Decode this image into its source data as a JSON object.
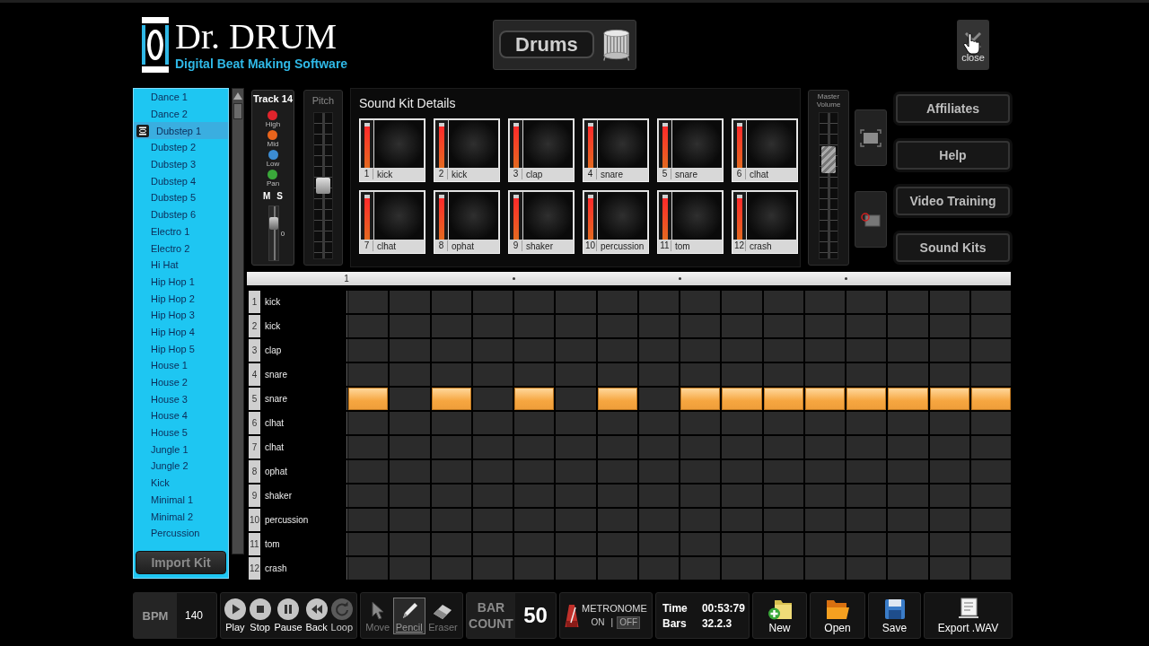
{
  "header": {
    "logo": {
      "title": "Dr. DRUM",
      "subtitle": "Digital Beat Making Software"
    },
    "instrument": {
      "label": "Drums"
    },
    "close": {
      "label": "close"
    }
  },
  "kits": {
    "items": [
      {
        "label": "Dance 1",
        "selected": false
      },
      {
        "label": "Dance 2",
        "selected": false
      },
      {
        "label": "Dubstep 1",
        "selected": true
      },
      {
        "label": "Dubstep 2",
        "selected": false
      },
      {
        "label": "Dubstep 3",
        "selected": false
      },
      {
        "label": "Dubstep 4",
        "selected": false
      },
      {
        "label": "Dubstep 5",
        "selected": false
      },
      {
        "label": "Dubstep 6",
        "selected": false
      },
      {
        "label": "Electro 1",
        "selected": false
      },
      {
        "label": "Electro 2",
        "selected": false
      },
      {
        "label": "Hi Hat",
        "selected": false
      },
      {
        "label": "Hip Hop 1",
        "selected": false
      },
      {
        "label": "Hip Hop 2",
        "selected": false
      },
      {
        "label": "Hip Hop 3",
        "selected": false
      },
      {
        "label": "Hip Hop 4",
        "selected": false
      },
      {
        "label": "Hip Hop 5",
        "selected": false
      },
      {
        "label": "House 1",
        "selected": false
      },
      {
        "label": "House 2",
        "selected": false
      },
      {
        "label": "House 3",
        "selected": false
      },
      {
        "label": "House 4",
        "selected": false
      },
      {
        "label": "House 5",
        "selected": false
      },
      {
        "label": "Jungle 1",
        "selected": false
      },
      {
        "label": "Jungle 2",
        "selected": false
      },
      {
        "label": "Kick",
        "selected": false
      },
      {
        "label": "Minimal 1",
        "selected": false
      },
      {
        "label": "Minimal 2",
        "selected": false
      },
      {
        "label": "Percussion",
        "selected": false
      }
    ],
    "import_button": "Import Kit"
  },
  "track": {
    "title": "Track 14",
    "knobs": [
      {
        "label": "High",
        "color": "#e0242c"
      },
      {
        "label": "Mid",
        "color": "#e8641c"
      },
      {
        "label": "Low",
        "color": "#3c8cd2"
      },
      {
        "label": "Pan",
        "color": "#3aa83a"
      }
    ],
    "mute_label": "M",
    "solo_label": "S",
    "volume": {
      "level": 0.75,
      "reading": "0"
    }
  },
  "pitch": {
    "label": "Pitch",
    "level": 0.5
  },
  "sound_kit": {
    "title": "Sound Kit Details",
    "pads": [
      {
        "number": "1",
        "name": "kick",
        "level": 0.95
      },
      {
        "number": "2",
        "name": "kick",
        "level": 0.95
      },
      {
        "number": "3",
        "name": "clap",
        "level": 0.95
      },
      {
        "number": "4",
        "name": "snare",
        "level": 0.95
      },
      {
        "number": "5",
        "name": "snare",
        "level": 0.95
      },
      {
        "number": "6",
        "name": "clhat",
        "level": 0.95
      },
      {
        "number": "7",
        "name": "clhat",
        "level": 0.95
      },
      {
        "number": "8",
        "name": "ophat",
        "level": 0.95
      },
      {
        "number": "9",
        "name": "shaker",
        "level": 0.95
      },
      {
        "number": "10",
        "name": "percussion",
        "level": 0.95
      },
      {
        "number": "11",
        "name": "tom",
        "level": 0.95
      },
      {
        "number": "12",
        "name": "crash",
        "level": 0.95
      }
    ]
  },
  "master_volume": {
    "label": "Master Volume",
    "level": 0.72
  },
  "menu": {
    "buttons": [
      "Affiliates",
      "Help",
      "Video Training",
      "Sound Kits"
    ]
  },
  "timeline": {
    "start_label": "1"
  },
  "grid": {
    "rows": [
      {
        "number": "1",
        "name": "kick",
        "steps": [
          false,
          false,
          false,
          false,
          false,
          false,
          false,
          false,
          false,
          false,
          false,
          false,
          false,
          false,
          false,
          false
        ]
      },
      {
        "number": "2",
        "name": "kick",
        "steps": [
          false,
          false,
          false,
          false,
          false,
          false,
          false,
          false,
          false,
          false,
          false,
          false,
          false,
          false,
          false,
          false
        ]
      },
      {
        "number": "3",
        "name": "clap",
        "steps": [
          false,
          false,
          false,
          false,
          false,
          false,
          false,
          false,
          false,
          false,
          false,
          false,
          false,
          false,
          false,
          false
        ]
      },
      {
        "number": "4",
        "name": "snare",
        "steps": [
          false,
          false,
          false,
          false,
          false,
          false,
          false,
          false,
          false,
          false,
          false,
          false,
          false,
          false,
          false,
          false
        ]
      },
      {
        "number": "5",
        "name": "snare",
        "steps": [
          true,
          false,
          true,
          false,
          true,
          false,
          true,
          false,
          true,
          true,
          true,
          true,
          true,
          true,
          true,
          true
        ]
      },
      {
        "number": "6",
        "name": "clhat",
        "steps": [
          false,
          false,
          false,
          false,
          false,
          false,
          false,
          false,
          false,
          false,
          false,
          false,
          false,
          false,
          false,
          false
        ]
      },
      {
        "number": "7",
        "name": "clhat",
        "steps": [
          false,
          false,
          false,
          false,
          false,
          false,
          false,
          false,
          false,
          false,
          false,
          false,
          false,
          false,
          false,
          false
        ]
      },
      {
        "number": "8",
        "name": "ophat",
        "steps": [
          false,
          false,
          false,
          false,
          false,
          false,
          false,
          false,
          false,
          false,
          false,
          false,
          false,
          false,
          false,
          false
        ]
      },
      {
        "number": "9",
        "name": "shaker",
        "steps": [
          false,
          false,
          false,
          false,
          false,
          false,
          false,
          false,
          false,
          false,
          false,
          false,
          false,
          false,
          false,
          false
        ]
      },
      {
        "number": "10",
        "name": "percussion",
        "steps": [
          false,
          false,
          false,
          false,
          false,
          false,
          false,
          false,
          false,
          false,
          false,
          false,
          false,
          false,
          false,
          false
        ]
      },
      {
        "number": "11",
        "name": "tom",
        "steps": [
          false,
          false,
          false,
          false,
          false,
          false,
          false,
          false,
          false,
          false,
          false,
          false,
          false,
          false,
          false,
          false
        ]
      },
      {
        "number": "12",
        "name": "crash",
        "steps": [
          false,
          false,
          false,
          false,
          false,
          false,
          false,
          false,
          false,
          false,
          false,
          false,
          false,
          false,
          false,
          false
        ]
      }
    ]
  },
  "toolbar": {
    "bpm": {
      "label": "BPM",
      "value": "140"
    },
    "transport": [
      {
        "kind": "play",
        "label": "Play",
        "disabled": false
      },
      {
        "kind": "stop",
        "label": "Stop",
        "disabled": false
      },
      {
        "kind": "pause",
        "label": "Pause",
        "disabled": false
      },
      {
        "kind": "back",
        "label": "Back",
        "disabled": false
      },
      {
        "kind": "loop",
        "label": "Loop",
        "disabled": true
      }
    ],
    "tools": [
      {
        "kind": "move",
        "label": "Move",
        "selected": false
      },
      {
        "kind": "pencil",
        "label": "Pencil",
        "selected": true
      },
      {
        "kind": "eraser",
        "label": "Eraser",
        "selected": false
      }
    ],
    "bar_count": {
      "label": "BAR COUNT",
      "value": "50"
    },
    "metronome": {
      "label": "METRONOME",
      "separator": "|",
      "options": [
        {
          "label": "ON",
          "selected": false
        },
        {
          "label": "OFF",
          "selected": true
        }
      ]
    },
    "clock": [
      {
        "label": "Time",
        "value": "00:53:79"
      },
      {
        "label": "Bars",
        "value": "32.2.3"
      }
    ],
    "file_buttons": [
      {
        "kind": "new",
        "label": "New"
      },
      {
        "kind": "open",
        "label": "Open"
      },
      {
        "kind": "save",
        "label": "Save"
      },
      {
        "kind": "export",
        "label": "Export .WAV"
      }
    ]
  }
}
